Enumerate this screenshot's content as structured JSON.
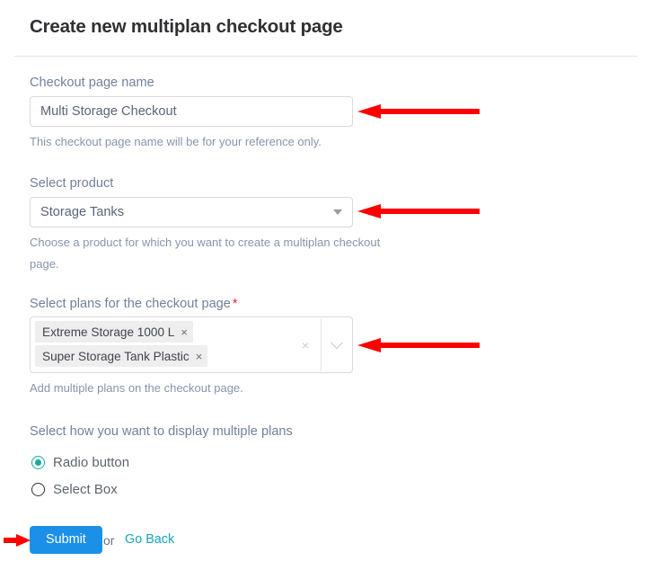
{
  "header": {
    "title": "Create new multiplan checkout page"
  },
  "form": {
    "checkout_name": {
      "label": "Checkout page name",
      "value": "Multi Storage Checkout",
      "placeholder": "Checkout page name",
      "help": "This checkout page name will be for your reference only."
    },
    "product": {
      "label": "Select product",
      "value": "Storage Tanks",
      "help": "Choose a product for which you want to create a multiplan checkout page."
    },
    "plans": {
      "label": "Select plans for the checkout page",
      "required_mark": "*",
      "tags": [
        {
          "label": "Extreme Storage 1000 L",
          "remove": "×"
        },
        {
          "label": "Super Storage Tank Plastic",
          "remove": "×"
        }
      ],
      "clear_all": "×",
      "help": "Add multiple plans on the checkout page."
    },
    "display_mode": {
      "label": "Select how you want to display multiple plans",
      "options": [
        {
          "label": "Radio button",
          "selected": true
        },
        {
          "label": "Select Box",
          "selected": false
        }
      ]
    }
  },
  "footer": {
    "submit_label": "Submit",
    "or_label": "or",
    "go_back_label": "Go Back"
  },
  "colors": {
    "submit_blue": "#1a90e8",
    "link_teal": "#17a5b8",
    "radio_teal": "#19a8a0",
    "required_red": "#f5222d",
    "annotation_red": "#fe0000",
    "label_gray": "#72809d",
    "help_gray": "#8794ad"
  },
  "annotations": [
    {
      "name": "arrow-to-checkout-name-input",
      "direction": "left"
    },
    {
      "name": "arrow-to-product-select",
      "direction": "left"
    },
    {
      "name": "arrow-to-plans-multiselect",
      "direction": "left"
    },
    {
      "name": "arrow-to-submit-button",
      "direction": "right"
    }
  ]
}
